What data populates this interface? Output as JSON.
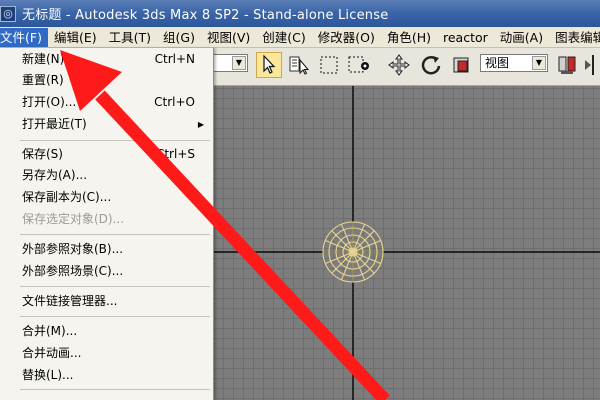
{
  "window": {
    "title": "无标题 - Autodesk 3ds Max 8 SP2  - Stand-alone License",
    "icon": "3ds-max-icon"
  },
  "menubar": {
    "items": [
      "文件(F)",
      "编辑(E)",
      "工具(T)",
      "组(G)",
      "视图(V)",
      "创建(C)",
      "修改器(O)",
      "角色(H)",
      "reactor",
      "动画(A)",
      "图表编辑器("
    ],
    "active_index": 0
  },
  "toolbar": {
    "view_select": "视图",
    "icons": [
      "select-arrow-icon",
      "select-by-name-icon",
      "rect-select-icon",
      "window-crossing-icon",
      "move-icon",
      "rotate-icon",
      "scale-icon",
      "mirror-icon"
    ]
  },
  "file_menu": {
    "items": [
      {
        "label": "新建(N)...",
        "shortcut": "Ctrl+N"
      },
      {
        "label": "重置(R)",
        "shortcut": ""
      },
      {
        "label": "打开(O)...",
        "shortcut": "Ctrl+O"
      },
      {
        "label": "打开最近(T)",
        "shortcut": "",
        "submenu": true
      },
      {
        "label": "保存(S)",
        "shortcut": "Ctrl+S"
      },
      {
        "label": "另存为(A)...",
        "shortcut": ""
      },
      {
        "label": "保存副本为(C)...",
        "shortcut": ""
      },
      {
        "label": "保存选定对象(D)...",
        "shortcut": "",
        "disabled": true
      },
      {
        "label": "外部参照对象(B)...",
        "shortcut": ""
      },
      {
        "label": "外部参照场景(C)...",
        "shortcut": ""
      },
      {
        "label": "文件链接管理器...",
        "shortcut": ""
      },
      {
        "label": "合并(M)...",
        "shortcut": ""
      },
      {
        "label": "合并动画...",
        "shortcut": ""
      },
      {
        "label": "替换(L)...",
        "shortcut": ""
      }
    ]
  },
  "colors": {
    "menu_highlight": "#316ac5",
    "annotation_arrow": "#ff1a1a",
    "sphere_wire": "#e8d690"
  }
}
